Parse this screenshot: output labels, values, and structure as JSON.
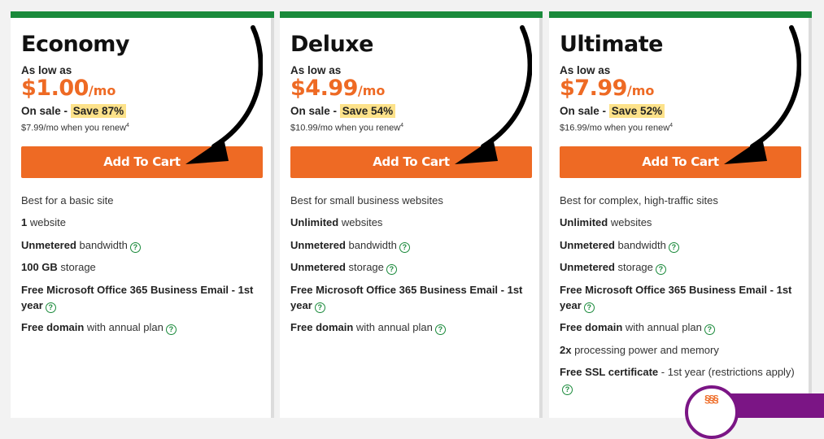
{
  "plans": [
    {
      "name": "Economy",
      "as_low_as": "As low as",
      "price": "$1.00",
      "per": "/mo",
      "sale_prefix": "On sale - ",
      "save": "Save 87%",
      "renew": "$7.99/mo when you renew",
      "renew_sup": "4",
      "cta": "Add To Cart",
      "features": [
        {
          "bold": "",
          "text": "Best for a basic site",
          "help": false
        },
        {
          "bold": "1",
          "text": " website",
          "help": false
        },
        {
          "bold": "Unmetered",
          "text": " bandwidth",
          "help": true
        },
        {
          "bold": "100 GB",
          "text": " storage",
          "help": false
        },
        {
          "bold": "Free Microsoft Office 365 Business Email - 1st year",
          "text": "",
          "help": true
        },
        {
          "bold": "Free domain",
          "text": " with annual plan",
          "help": true
        }
      ]
    },
    {
      "name": "Deluxe",
      "as_low_as": "As low as",
      "price": "$4.99",
      "per": "/mo",
      "sale_prefix": "On sale - ",
      "save": "Save 54%",
      "renew": "$10.99/mo when you renew",
      "renew_sup": "4",
      "cta": "Add To Cart",
      "features": [
        {
          "bold": "",
          "text": "Best for small business websites",
          "help": false
        },
        {
          "bold": "Unlimited",
          "text": " websites",
          "help": false
        },
        {
          "bold": "Unmetered",
          "text": " bandwidth",
          "help": true
        },
        {
          "bold": "Unmetered",
          "text": " storage",
          "help": true
        },
        {
          "bold": "Free Microsoft Office 365 Business Email - 1st year",
          "text": "",
          "help": true
        },
        {
          "bold": "Free domain",
          "text": " with annual plan",
          "help": true
        }
      ]
    },
    {
      "name": "Ultimate",
      "as_low_as": "As low as",
      "price": "$7.99",
      "per": "/mo",
      "sale_prefix": "On sale - ",
      "save": "Save 52%",
      "renew": "$16.99/mo when you renew",
      "renew_sup": "4",
      "cta": "Add To Cart",
      "features": [
        {
          "bold": "",
          "text": "Best for complex, high-traffic sites",
          "help": false
        },
        {
          "bold": "Unlimited",
          "text": " websites",
          "help": false
        },
        {
          "bold": "Unmetered",
          "text": " bandwidth",
          "help": true
        },
        {
          "bold": "Unmetered",
          "text": " storage",
          "help": true
        },
        {
          "bold": "Free Microsoft Office 365 Business Email - 1st year",
          "text": "",
          "help": true
        },
        {
          "bold": "Free domain",
          "text": " with annual plan",
          "help": true
        },
        {
          "bold": "2x",
          "text": " processing power and memory",
          "help": false
        },
        {
          "bold": "Free SSL certificate",
          "text": " - 1st year (restrictions apply)",
          "help": true
        }
      ]
    }
  ],
  "help_glyph": "?",
  "chat": {
    "steam_glyph": "§§§"
  },
  "colors": {
    "accent_orange": "#ee6a24",
    "brand_green": "#1a8a3b",
    "highlight": "#fde28a",
    "chat_purple": "#7b1585"
  }
}
